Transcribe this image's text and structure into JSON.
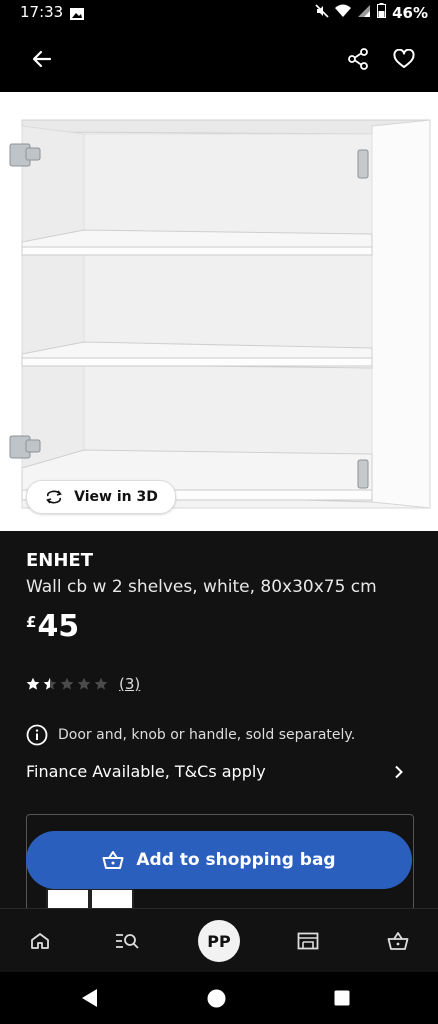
{
  "status": {
    "time": "17:33",
    "battery": "46%"
  },
  "product": {
    "brand": "ENHET",
    "description": "Wall cb w 2 shelves, white, 80x30x75 cm",
    "price_currency": "£",
    "price_value": "45",
    "rating_value": 1.5,
    "rating_max": 5,
    "rating_count": "(3)"
  },
  "view3d_label": "View in 3D",
  "notice": "Door and, knob or handle, sold separately.",
  "finance": "Finance Available, T&Cs apply",
  "add_button": "Add to shopping bag",
  "bottom_nav": {
    "avatar_initials": "PP"
  },
  "icons": {
    "back": "arrow-left-icon",
    "share": "share-icon",
    "favorite": "heart-icon",
    "view3d": "rotate-3d-icon",
    "info": "info-icon",
    "chevron": "chevron-right-icon",
    "bag": "shopping-bag-icon",
    "home": "home-icon",
    "search": "search-list-icon",
    "store": "store-icon",
    "basket": "basket-icon"
  },
  "colors": {
    "accent": "#2a5fbd",
    "background": "#121212",
    "bar": "#000000"
  }
}
